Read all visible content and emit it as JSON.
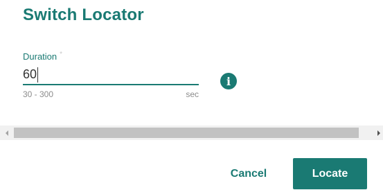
{
  "dialog": {
    "title": "Switch Locator"
  },
  "duration_field": {
    "label": "Duration",
    "required_marker": "*",
    "value": "60",
    "range_hint": "30 - 300",
    "unit": "sec"
  },
  "icons": {
    "info": "info-icon",
    "info_glyph": "i"
  },
  "actions": {
    "cancel_label": "Cancel",
    "locate_label": "Locate"
  },
  "colors": {
    "accent": "#1a7a73"
  }
}
